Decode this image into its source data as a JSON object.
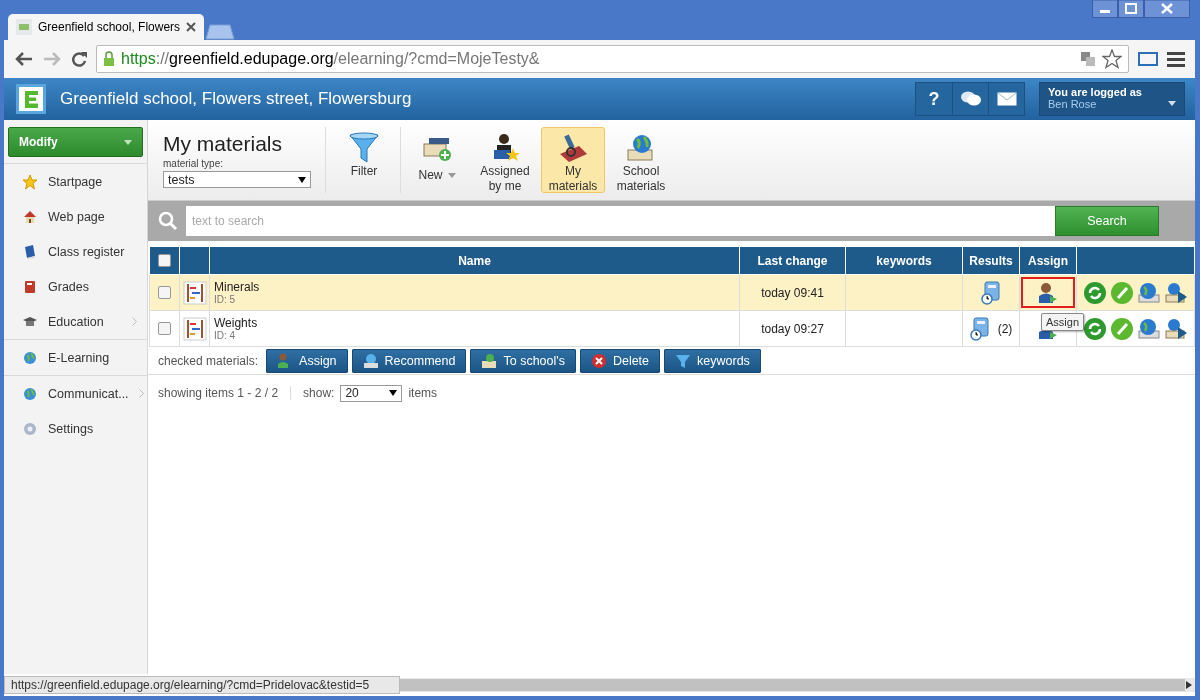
{
  "browser": {
    "tab_title": "Greenfield school, Flowers",
    "url_parts": [
      {
        "kind": "scheme",
        "text": "https"
      },
      {
        "kind": "path",
        "text": "://"
      },
      {
        "kind": "host",
        "text": "greenfield.edupage.org"
      },
      {
        "kind": "path",
        "text": "/elearning/?cmd=MojeTesty&"
      }
    ],
    "status_url": "https://greenfield.edupage.org/elearning/?cmd=Pridelovac&testid=5"
  },
  "header": {
    "school_name": "Greenfield school, Flowers street, Flowersburg",
    "help_label": "?",
    "user_caption": "You are logged as",
    "user_name": "Ben Rose"
  },
  "sidebar": {
    "modify_button": "Modify",
    "items": [
      {
        "label": "Startpage",
        "has_submenu": false
      },
      {
        "label": "Web page",
        "has_submenu": false
      },
      {
        "label": "Class register",
        "has_submenu": false
      },
      {
        "label": "Grades",
        "has_submenu": false
      },
      {
        "label": "Education",
        "has_submenu": true
      },
      {
        "label": "E-Learning",
        "has_submenu": false
      },
      {
        "label": "Communicat...",
        "has_submenu": true
      },
      {
        "label": "Settings",
        "has_submenu": false
      }
    ]
  },
  "toolbar": {
    "title": "My materials",
    "type_label": "material type:",
    "type_value": "tests",
    "tools": [
      {
        "label": "Filter",
        "selected": false,
        "dropdown": false
      },
      {
        "label": "New",
        "selected": false,
        "dropdown": true
      },
      {
        "label": "Assigned by me",
        "selected": false,
        "dropdown": false
      },
      {
        "label": "My materials",
        "selected": true,
        "dropdown": false
      },
      {
        "label": "School materials",
        "selected": false,
        "dropdown": false
      }
    ]
  },
  "search": {
    "placeholder": "text to search",
    "button": "Search"
  },
  "table": {
    "select_all_checked": false,
    "columns": [
      "Name",
      "Last change",
      "keywords",
      "Results",
      "Assign"
    ],
    "rows": [
      {
        "name": "Minerals",
        "id": "ID: 5",
        "last_change": "today 09:41",
        "checked": false,
        "selected": true,
        "assign_marked": true
      },
      {
        "name": "Weights",
        "id": "ID: 4",
        "last_change": "today 09:27",
        "results": "(2)",
        "checked": false,
        "selected": false,
        "assign_marked": false
      }
    ],
    "tooltip": "Assign"
  },
  "bulk_actions": {
    "label": "checked materials:",
    "buttons": [
      "Assign",
      "Recommend",
      "To school's",
      "Delete",
      "keywords"
    ]
  },
  "pager": {
    "summary": "showing items 1 - 2 / 2",
    "show_label": "show:",
    "page_size": "20",
    "items_label": "items"
  }
}
